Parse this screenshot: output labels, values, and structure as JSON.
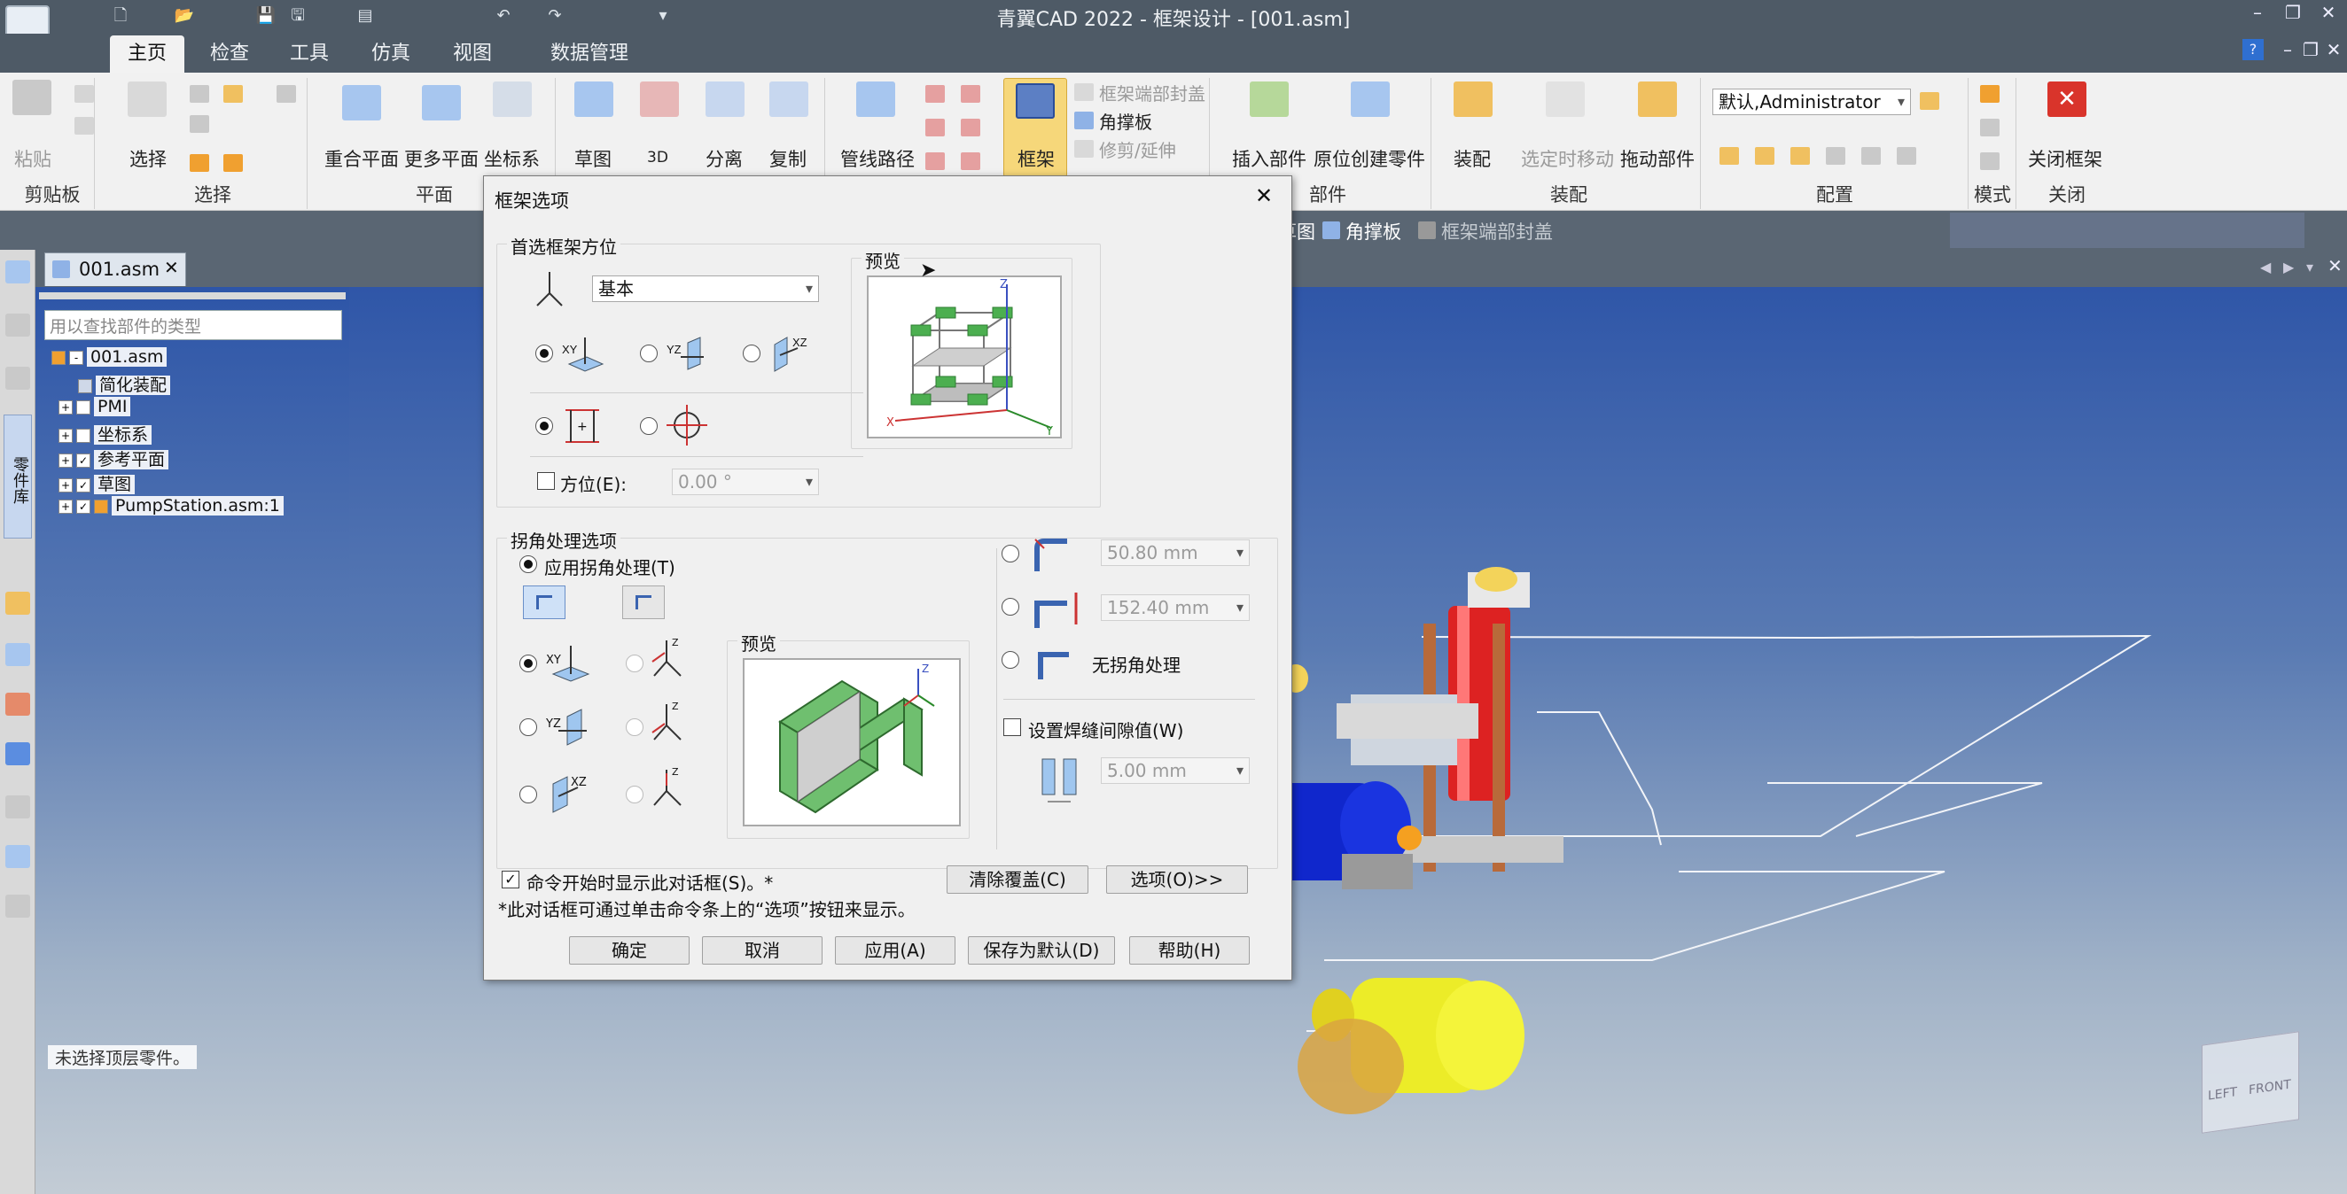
{
  "app": {
    "title": "青翼CAD 2022 - 框架设计 - [001.asm]"
  },
  "tabs": [
    "主页",
    "检查",
    "工具",
    "仿真",
    "视图",
    "数据管理"
  ],
  "ribbon": {
    "paste": "粘贴",
    "clipboard_group": "剪贴板",
    "select": "选择",
    "select_group": "选择",
    "coincident_plane": "重合平面",
    "more_planes": "更多平面",
    "coordinate_system": "坐标系",
    "plane_group": "平面",
    "sketch": "草图",
    "sketch_3d": "3D",
    "detach": "分离",
    "copy": "复制",
    "pipe_path": "管线路径",
    "frame": "框架",
    "frame_end_cap": "框架端部封盖",
    "gusset": "角撑板",
    "trim_extend": "修剪/延伸",
    "insert_part": "插入部件",
    "create_in_place": "原位创建零件",
    "parts_group": "部件",
    "assemble": "装配",
    "move_when_selected": "选定时移动",
    "drag_part": "拖动部件",
    "assembly_group": "装配",
    "config_value": "默认,Administrator",
    "config_group": "配置",
    "mode_group": "模式",
    "close_frame": "关闭框架",
    "close_group": "关闭"
  },
  "cmdbar": {
    "sketch": "草图",
    "gusset": "角撑板",
    "frame_end_cap": "框架端部封盖"
  },
  "document": {
    "tab": "001.asm",
    "search_placeholder": "用以查找部件的类型",
    "status": "未选择顶层零件。"
  },
  "tree": {
    "root": "001.asm",
    "simplified": "简化装配",
    "pmi": "PMI",
    "csys": "坐标系",
    "ref_planes": "参考平面",
    "sketch": "草图",
    "pump": "PumpStation.asm:1"
  },
  "left_strip_label": "零件库",
  "viewcube": {
    "left": "LEFT",
    "front": "FRONT"
  },
  "dialog": {
    "title": "框架选项",
    "preferred_orientation": "首选框架方位",
    "orientation_value": "基本",
    "plane_xy": "XY",
    "plane_yz": "YZ",
    "plane_xz": "XZ",
    "preview": "预览",
    "orientation_angle_label": "方位(E):",
    "orientation_angle_value": "0.00 °",
    "corner_options": "拐角处理选项",
    "apply_corner": "应用拐角处理(T)",
    "preview2": "预览",
    "dim1": "50.80 mm",
    "dim2": "152.40 mm",
    "no_corner": "无拐角处理",
    "weld_gap": "设置焊缝间隙值(W)",
    "weld_value": "5.00 mm",
    "show_on_start": "命令开始时显示此对话框(S)。*",
    "note": "*此对话框可通过单击命令条上的“选项”按钮来显示。",
    "clear_override": "清除覆盖(C)",
    "options": "选项(O)>>",
    "ok": "确定",
    "cancel": "取消",
    "apply": "应用(A)",
    "save_default": "保存为默认(D)",
    "help": "帮助(H)"
  },
  "colors": {
    "accent": "#2f6fd0",
    "frame_green": "#4caf50",
    "close_red": "#d9342b"
  }
}
